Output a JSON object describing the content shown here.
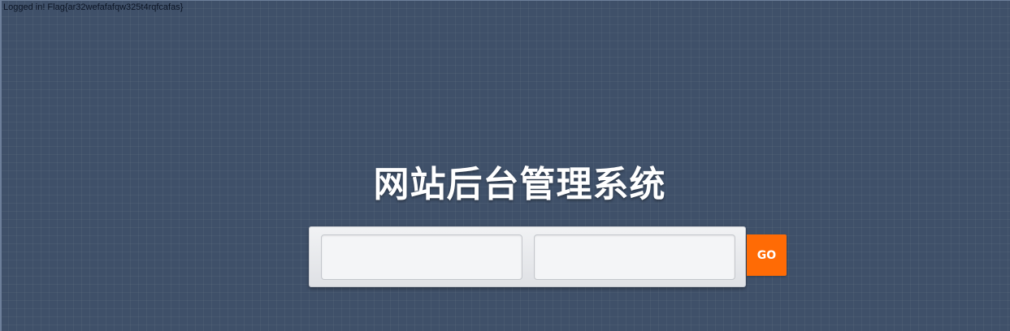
{
  "status": {
    "text": "Logged in! Flag{ar32wefafafqw325t4rqfcafas}"
  },
  "header": {
    "title": "网站后台管理系统"
  },
  "login_form": {
    "username_value": "",
    "password_value": "",
    "submit_label": "GO"
  },
  "colors": {
    "background": "#3f5069",
    "accent": "#ff6b05",
    "panel": "#e6e8eb"
  }
}
